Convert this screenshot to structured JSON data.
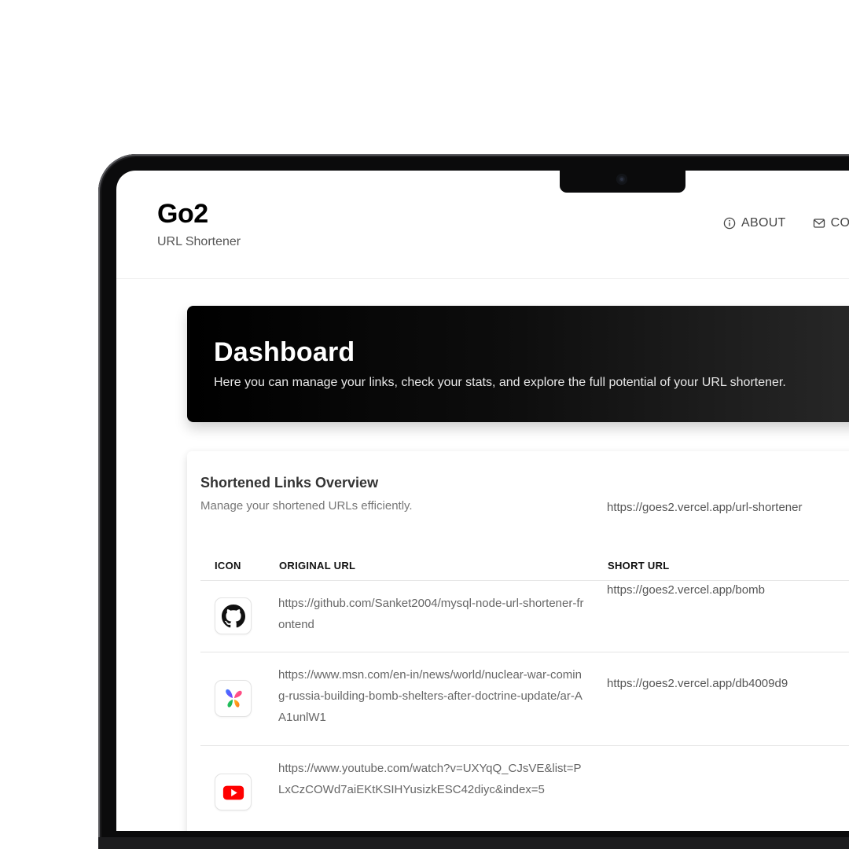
{
  "header": {
    "title": "Go2",
    "subtitle": "URL Shortener",
    "nav": [
      {
        "label": "ABOUT",
        "icon": "info-circle-icon"
      },
      {
        "label": "CONTACT",
        "icon": "mail-icon"
      }
    ]
  },
  "hero": {
    "title": "Dashboard",
    "description": "Here you can manage your links, check your stats, and explore the full potential of your URL shortener."
  },
  "links_card": {
    "title": "Shortened Links Overview",
    "subtitle": "Manage your shortened URLs efficiently.",
    "columns": [
      "ICON",
      "ORIGINAL URL",
      "SHORT URL"
    ],
    "rows": [
      {
        "icon": "github-icon",
        "original_url": "https://github.com/Sanket2004/mysql-node-url-shortener-frontend",
        "short_url": "https://goes2.vercel.app/url-shortener"
      },
      {
        "icon": "msn-butterfly-icon",
        "original_url": "https://www.msn.com/en-in/news/world/nuclear-war-coming-russia-building-bomb-shelters-after-doctrine-update/ar-AA1unlW1",
        "short_url": "https://goes2.vercel.app/bomb"
      },
      {
        "icon": "youtube-icon",
        "original_url": "https://www.youtube.com/watch?v=UXYqQ_CJsVE&list=PLxCzCOWd7aiEKtKSIHYusizkESC42diyc&index=5",
        "short_url": "https://goes2.vercel.app/db4009d9"
      }
    ]
  },
  "colors": {
    "hero_background": "#000000",
    "text_primary": "#111111",
    "text_muted": "#666666",
    "youtube_red": "#ff0000"
  }
}
